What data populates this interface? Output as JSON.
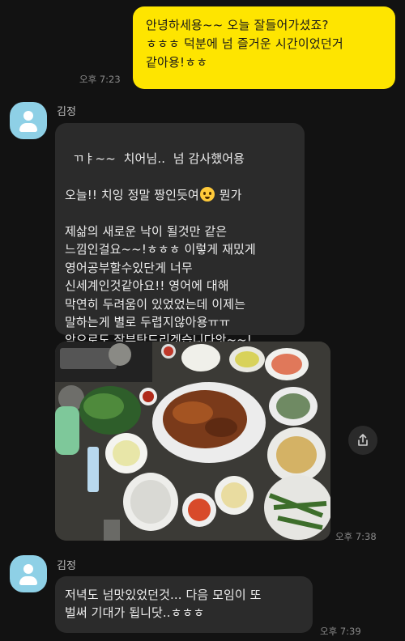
{
  "messages": {
    "outgoing_1": {
      "text": "안녕하세용~~ 오늘 잘들어가셨죠?\nㅎㅎㅎ 덕분에 넘 즐거운 시간이었던거\n같아용!ㅎㅎ",
      "time": "오후 7:23"
    },
    "incoming_1": {
      "sender": "김정",
      "line1": "ㄲㅑ~~  치어님..  넘 감사했어용",
      "line2a": "오늘!! 치잉 정말 짱인듯여",
      "line2b": " 뭔가",
      "line3_to_8": "제삶의 새로운 낙이 될것만 같은\n느낌인걸요~~!ㅎㅎㅎ 이렇게 재밌게\n영어공부할수있단게 너무\n신세계인것같아요!! 영어에 대해\n막연히 두려움이 있었었는데 이제는\n말하는게 별로 두렵지않아용ㅠㅠ\n앞으로도 잘부탁드리겟습니다앗~~!",
      "photo_time": "오후 7:38"
    },
    "incoming_2": {
      "sender": "김정",
      "text": "저녁도 넘맛있었던것... 다음 모임이 또\n벌써 기대가 됩니닷..ㅎㅎㅎ",
      "time": "오후 7:39"
    }
  },
  "colors": {
    "background": "#121212",
    "outgoing_bubble": "#fee500",
    "incoming_bubble": "#2b2b2b",
    "avatar": "#8ed0e6"
  },
  "icons": [
    "avatar-icon",
    "share-icon",
    "pleading-face-emoji",
    "folded-hands-emoji",
    "kissing-face-emoji"
  ]
}
